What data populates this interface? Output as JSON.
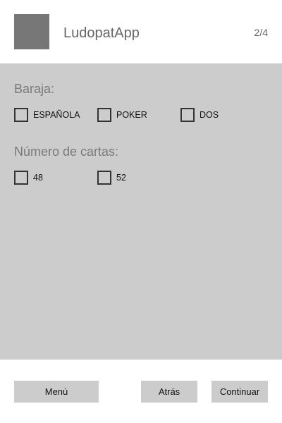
{
  "header": {
    "app_title": "LudopatApp",
    "step": "2/4"
  },
  "deck": {
    "title": "Baraja:",
    "options": [
      {
        "label": "ESPAÑOLA",
        "checked": false
      },
      {
        "label": "POKER",
        "checked": false
      },
      {
        "label": "DOS",
        "checked": false
      }
    ]
  },
  "card_count": {
    "title": "Número de cartas:",
    "options": [
      {
        "label": "48",
        "checked": false
      },
      {
        "label": "52",
        "checked": false
      }
    ]
  },
  "footer": {
    "menu_label": "Menú",
    "back_label": "Atrás",
    "continue_label": "Continuar"
  },
  "colors": {
    "content_background": "#cccccc",
    "logo_placeholder": "#777777",
    "button_background": "#cccccc"
  }
}
